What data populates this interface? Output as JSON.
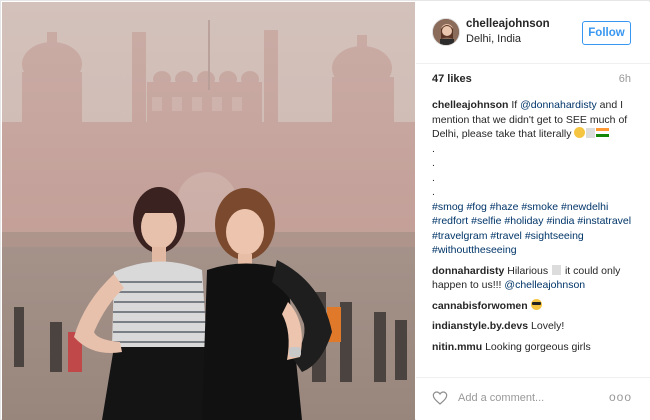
{
  "post": {
    "username": "chelleajohnson",
    "location": "Delhi, India",
    "follow_label": "Follow",
    "likes": "47 likes",
    "time": "6h"
  },
  "caption": {
    "user": "chelleajohnson",
    "text_1": "If",
    "mention_1": "@donnahardisty",
    "text_2": "and I mention that we didn't get to SEE much of Delhi, please take that literally",
    "dot": ".",
    "hashtags": [
      "#smog",
      "#fog",
      "#haze",
      "#smoke",
      "#newdelhi",
      "#redfort",
      "#selfie",
      "#holiday",
      "#india",
      "#instatravel",
      "#travelgram",
      "#travel",
      "#sightseeing",
      "#withouttheseeing"
    ]
  },
  "comments": [
    {
      "user": "donnahardisty",
      "text_1": "Hilarious",
      "text_2": "it could only happen to us!!!",
      "mention": "@chelleajohnson"
    },
    {
      "user": "cannabisforwomen",
      "text": ""
    },
    {
      "user": "indianstyle.by.devs",
      "text": "Lovely!"
    },
    {
      "user": "nitin.mmu",
      "text": "Looking gorgeous girls"
    }
  ],
  "footer": {
    "add_comment_placeholder": "Add a comment...",
    "more_label": "ooo"
  },
  "icons": {
    "heart": "heart-icon",
    "more": "more-options-icon"
  },
  "colors": {
    "link": "#003569",
    "follow": "#3897f0",
    "muted": "#999999"
  }
}
